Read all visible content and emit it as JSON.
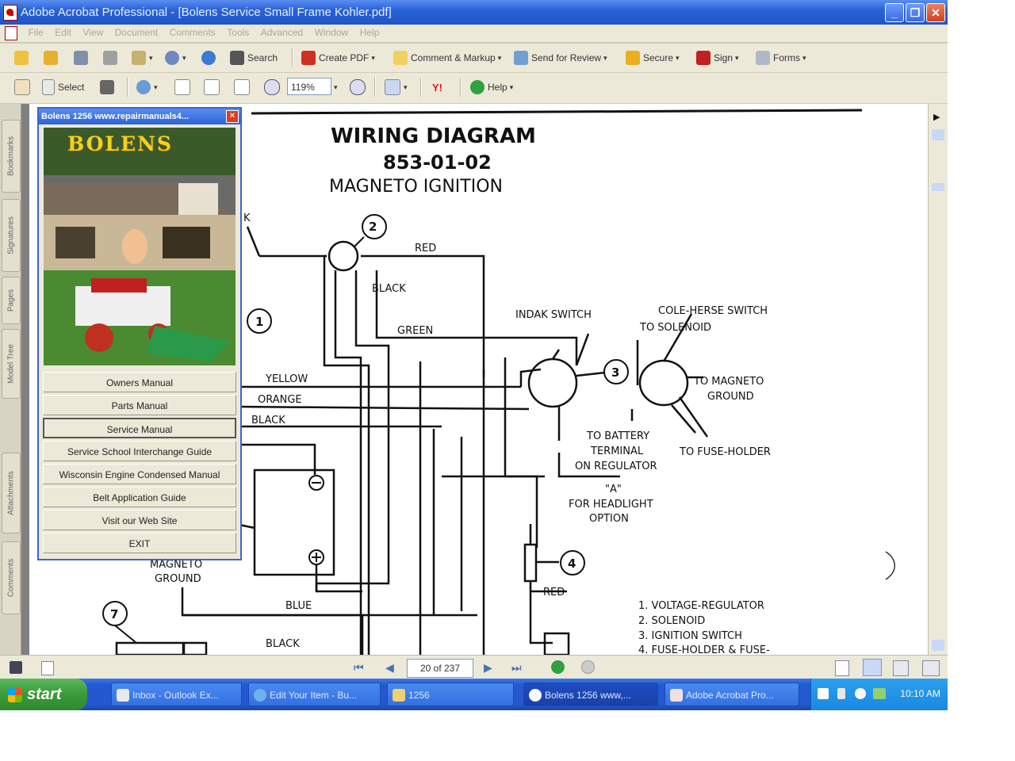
{
  "window": {
    "title": "Adobe Acrobat Professional - [Bolens Service Small Frame Kohler.pdf]",
    "controls": {
      "minimize": "_",
      "restore": "❐",
      "close": "✕"
    }
  },
  "menu": [
    "File",
    "Edit",
    "View",
    "Document",
    "Comments",
    "Tools",
    "Advanced",
    "Window",
    "Help"
  ],
  "toolbar1": {
    "search": "Search",
    "create_pdf": "Create PDF",
    "comment_markup": "Comment & Markup",
    "send_review": "Send for Review",
    "secure": "Secure",
    "sign": "Sign",
    "forms": "Forms"
  },
  "toolbar2": {
    "select": "Select",
    "zoom": "119%",
    "help": "Help"
  },
  "nav_tabs": [
    "Bookmarks",
    "Signatures",
    "Pages",
    "Model Tree",
    "Attachments",
    "Comments"
  ],
  "popup": {
    "title": "Bolens 1256  www.repairmanuals4...",
    "brand": "BOLENS",
    "buttons": [
      "Owners Manual",
      "Parts Manual",
      "Service Manual",
      "Service School Interchange Guide",
      "Wisconsin Engine Condensed Manual",
      "Belt Application Guide",
      "Visit our Web Site",
      "EXIT"
    ],
    "selected": "Service Manual"
  },
  "diagram": {
    "title": "WIRING DIAGRAM",
    "number": "853-01-02",
    "subtitle": "MAGNETO  IGNITION",
    "labels": {
      "red": "RED",
      "red2": "RED",
      "black": "BLACK",
      "black2": "BLACK",
      "black3": "BLACK",
      "green": "GREEN",
      "yellow": "YELLOW",
      "orange": "ORANGE",
      "blue": "BLUE",
      "indak": "INDAK SWITCH",
      "cole": "COLE-HERSE SWITCH",
      "to_solenoid": "TO SOLENOID",
      "to_magneto": "TO MAGNETO",
      "ground": "GROUND",
      "to_battery": "TO BATTERY",
      "terminal": "TERMINAL",
      "on_regulator": "ON REGULATOR",
      "to_fuse": "TO FUSE-HOLDER",
      "option_a": "\"A\"",
      "headlight": "FOR HEADLIGHT",
      "option": "OPTION",
      "magneto": "MAGNETO",
      "ground2": "GROUND",
      "k": "K"
    },
    "callouts": [
      "1",
      "2",
      "3",
      "4",
      "7"
    ],
    "legend": [
      "1.  VOLTAGE-REGULATOR",
      "2.  SOLENOID",
      "3.  IGNITION SWITCH",
      "4.  FUSE-HOLDER & FUSE-"
    ]
  },
  "status": {
    "page": "20 of 237"
  },
  "taskbar": {
    "start": "start",
    "tasks": [
      "Inbox - Outlook Ex...",
      "Edit Your Item - Bu...",
      "1256",
      "Bolens 1256  www,...",
      "Adobe Acrobat Pro..."
    ],
    "clock": "10:10 AM"
  }
}
